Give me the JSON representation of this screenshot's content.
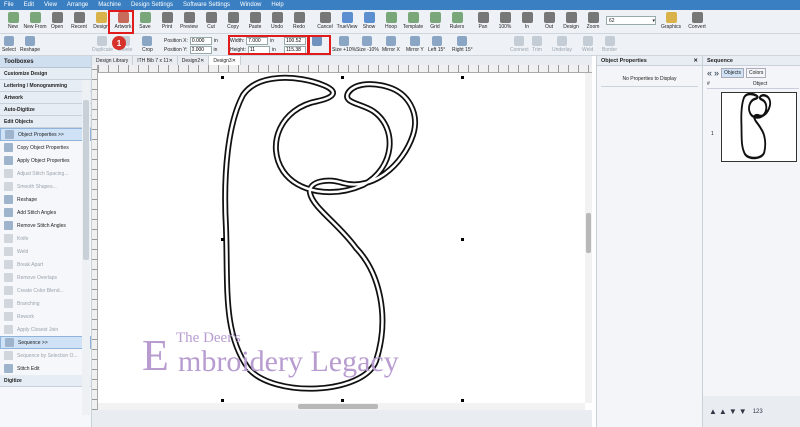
{
  "menu": [
    "File",
    "Edit",
    "View",
    "Arrange",
    "Machine",
    "Design Settings",
    "Software Settings",
    "Window",
    "Help"
  ],
  "toolbar1": [
    "New",
    "New From",
    "Open",
    "Recent",
    "Design",
    "Artwork",
    "Save",
    "Print",
    "Preview",
    "Cut",
    "Copy",
    "Paste",
    "Undo",
    "Redo",
    "Cancel",
    "TrueView",
    "Show",
    "Hoop",
    "Template",
    "Grid",
    "Rulers",
    "Pan",
    "100%",
    "In",
    "Out",
    "Design",
    "Zoom",
    "Graphics",
    "Convert"
  ],
  "zoom_value": "62",
  "toolbar2": {
    "select": "Select",
    "reshape": "Reshape",
    "duplicate": "Duplicate",
    "delete": "Delete",
    "crop": "Crop",
    "position_x_label": "Position X:",
    "position_y_label": "Position Y:",
    "position_x": "0.000",
    "position_y": "0.000",
    "unit": "in",
    "width_label": "Width:",
    "height_label": "Height:",
    "width": "7.000",
    "height": "11",
    "width_pct": "100.52",
    "height_pct": "115.38",
    "size_plus": "Size +10%",
    "size_minus": "Size -10%",
    "mirror_x": "Mirror X",
    "mirror_y": "Mirror Y",
    "left15": "Left 15°",
    "right15": "Right 15°",
    "connect": "Connect",
    "trim": "Trim",
    "underlay": "Underlay",
    "weld": "Weld",
    "border": "Border"
  },
  "callouts": {
    "one": "1",
    "two": "2"
  },
  "left_panel": {
    "title": "Toolboxes",
    "sections": [
      "Customize Design",
      "Lettering / Monogramming",
      "Artwork",
      "Auto-Digitize"
    ],
    "edit_objects": "Edit Objects",
    "items": [
      "Object Properties >>",
      "Copy Object Properties",
      "Apply Object Properties",
      "Adjust Stitch Spacing...",
      "Smooth Shapes...",
      "Reshape",
      "Add Stitch Angles",
      "Remove Stitch Angles",
      "Knife",
      "Weld",
      "Break Apart",
      "Remove Overlaps",
      "Create Color Blend...",
      "Branching",
      "Rework",
      "Apply Closest Join",
      "Sequence >>",
      "Sequence by Selection O...",
      "Stitch Edit"
    ],
    "digitize": "Digitize"
  },
  "tabs": [
    "Design Library",
    "ITH Bib 7 x 11",
    "Design2",
    "Design3"
  ],
  "object_properties": {
    "title": "Object Properties",
    "message": "No Properties to Display"
  },
  "sequence": {
    "title": "Sequence",
    "tab_objects": "Objects",
    "tab_colors": "Colors",
    "col_num": "#",
    "col_object": "Object",
    "row_num": "1",
    "footer_num": "123"
  },
  "watermark": {
    "line1": "The Deer's",
    "line2_initial": "E",
    "line2_rest": "mbroidery Legacy"
  },
  "colors": {
    "accent": "#3a7fc1",
    "highlight": "#e01b1b",
    "badge": "#d6312b",
    "watermark": "#b89cd0"
  }
}
